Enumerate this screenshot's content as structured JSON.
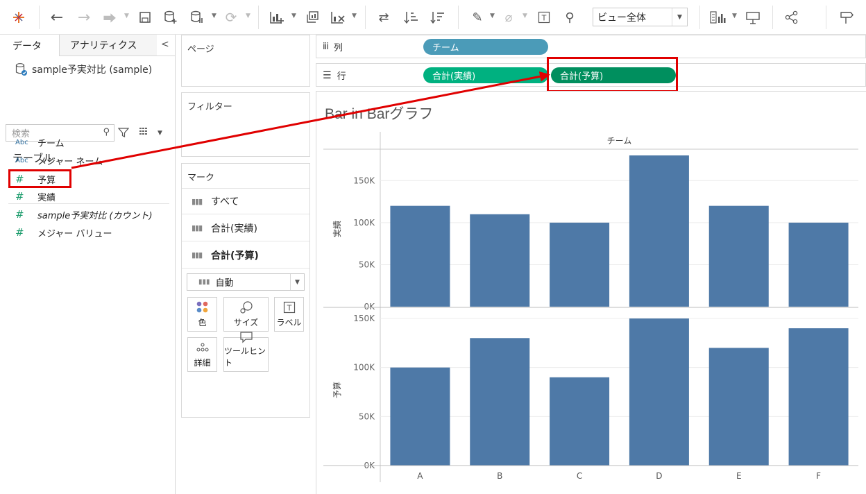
{
  "toolbar": {
    "view_select": "ビュー全体",
    "icons": [
      "tableau-logo-icon",
      "undo-icon",
      "redo-icon",
      "replay-icon",
      "save-icon",
      "new-datasource-icon",
      "pause-autoupdate-icon",
      "refresh-icon",
      "new-worksheet-icon",
      "duplicate-sheet-icon",
      "clear-sheet-icon",
      "swap-icon",
      "sort-asc-icon",
      "sort-desc-icon",
      "highlight-icon",
      "group-icon",
      "show-labels-icon",
      "pin-icon",
      "show-me-icon",
      "presentation-icon",
      "share-icon",
      "signpost-icon"
    ]
  },
  "data_pane": {
    "tabs": [
      "データ",
      "アナリティクス"
    ],
    "collapse_glyph": "<",
    "datasource": "sample予実対比 (sample)",
    "search_placeholder": "検索",
    "tables_title": "テーブル",
    "fields": [
      {
        "type": "Abc",
        "name": "チーム"
      },
      {
        "type": "Abc",
        "name": "メジャー ネーム"
      },
      {
        "type": "#",
        "name": "予算"
      },
      {
        "type": "#",
        "name": "実績"
      },
      {
        "type": "#",
        "name": "sample予実対比 (カウント)"
      },
      {
        "type": "#",
        "name": "メジャー バリュー"
      }
    ]
  },
  "cards": {
    "pages_title": "ページ",
    "filters_title": "フィルター",
    "marks_title": "マーク",
    "marks_rows": [
      "すべて",
      "合計(実績)",
      "合計(予算)"
    ],
    "mark_type": "自動",
    "buttons": [
      "色",
      "サイズ",
      "ラベル",
      "詳細",
      "ツールヒント"
    ]
  },
  "shelves": {
    "columns_label": "列",
    "rows_label": "行",
    "columns_pills": [
      "チーム"
    ],
    "rows_pills": [
      "合計(実績)",
      "合計(予算)"
    ]
  },
  "colors": {
    "bar": "#4e79a7",
    "pill_dimension": "#4b9bb8",
    "pill_measure": "#00b180",
    "pill_measure_selected": "#008f5e",
    "highlight": "#e00000"
  },
  "chart_data": {
    "type": "bar",
    "title": "Bar in Barグラフ",
    "column_header": "チーム",
    "categories": [
      "A",
      "B",
      "C",
      "D",
      "E",
      "F"
    ],
    "panes": [
      {
        "ylabel": "実績",
        "ticks": [
          "0K",
          "50K",
          "100K",
          "150K"
        ],
        "ylim": [
          0,
          180000
        ],
        "values": [
          120000,
          110000,
          100000,
          180000,
          120000,
          100000
        ]
      },
      {
        "ylabel": "予算",
        "ticks": [
          "0K",
          "50K",
          "100K",
          "150K"
        ],
        "ylim": [
          0,
          150000
        ],
        "values": [
          100000,
          130000,
          90000,
          150000,
          120000,
          140000
        ]
      }
    ]
  }
}
